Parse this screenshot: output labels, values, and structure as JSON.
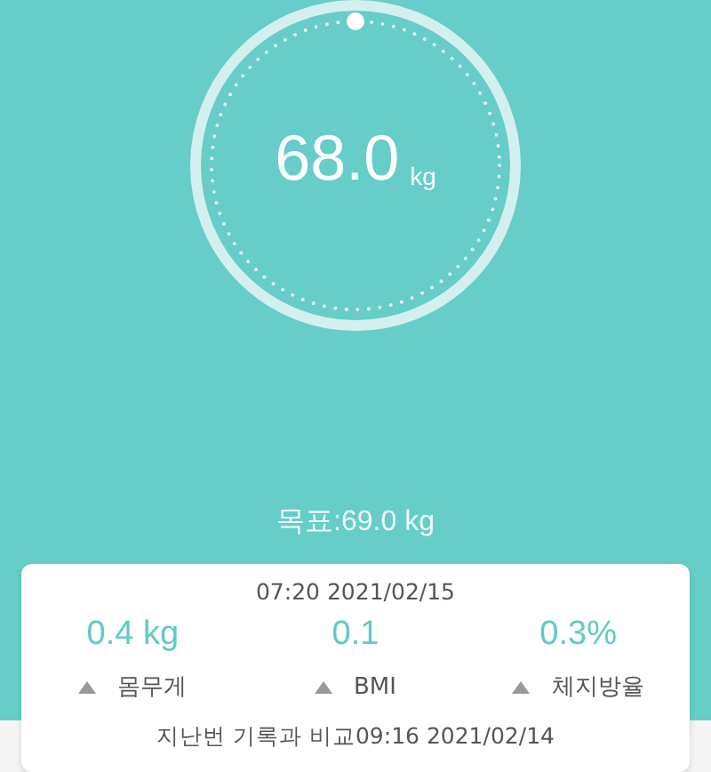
{
  "gauge": {
    "value": "68.0",
    "unit": "kg"
  },
  "goal": "목표:69.0 kg",
  "card": {
    "date": "07:20 2021/02/15",
    "metrics": [
      {
        "value": "0.4 kg",
        "label": "몸무게",
        "increased": true
      },
      {
        "value": "0.1",
        "label": "BMI",
        "increased": true
      },
      {
        "value": "0.3%",
        "label": "체지방율",
        "increased": true
      }
    ],
    "comparison": "지난번 기록과 비교09:16 2021/02/14"
  }
}
